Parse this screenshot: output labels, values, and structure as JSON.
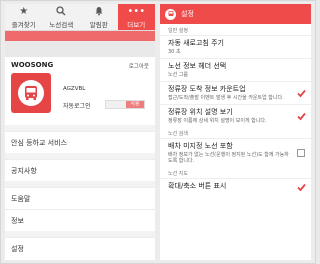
{
  "left": {
    "tabs": [
      {
        "label": "즐겨찾기",
        "icon": "star-icon"
      },
      {
        "label": "노선검색",
        "icon": "search-icon"
      },
      {
        "label": "알림판",
        "icon": "bell-icon"
      },
      {
        "label": "더보기",
        "icon": "more-icon",
        "active": true
      }
    ],
    "profile": {
      "name": "WOOSONG",
      "logout": "로그아웃",
      "user_id": "AGZVBL",
      "autologin_label": "자동로그인",
      "autologin_value": "사용"
    },
    "menu": [
      "안심 등하교 서비스",
      "공지사항",
      "도움말",
      "정보",
      "설정"
    ]
  },
  "right": {
    "title": "설정",
    "sections": {
      "general": "일반 설정",
      "route_search": "노선 검색",
      "route_map": "노선 지도"
    },
    "items": [
      {
        "title": "자동 새로고침 주기",
        "sub": "30 초"
      },
      {
        "title": "노선 정보 헤더 선택",
        "sub": "노선 그룹"
      },
      {
        "title": "정류장 도착 정보 카운트업",
        "sub": "접근/도착/출발 이벤트 발생 후 시간을 카운트업 합니다.",
        "checked": true
      },
      {
        "title": "정류장 위치 설명 보기",
        "sub": "정류장 이름에 상세 위치 설명이 보이게 합니다.",
        "checked": true
      },
      {
        "title": "배차 미지정 노선 포함",
        "sub": "배차 정보가 없는 노선(운행이 정지된 노선)도 함께 가능하도록 합니다.",
        "checked": false
      },
      {
        "title": "확대/축소 버튼 표시",
        "checked": true
      }
    ]
  },
  "colors": {
    "accent": "#ef4b4b"
  }
}
